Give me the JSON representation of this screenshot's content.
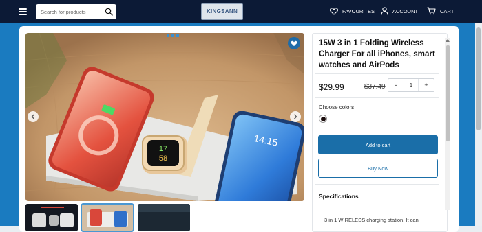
{
  "header": {
    "search_placeholder": "Search for products",
    "logo_text": "KINGSANN",
    "nav": {
      "favourites": "FAVOURITES",
      "account": "ACCOUNT",
      "cart": "CART"
    }
  },
  "product": {
    "title": "15W 3 in 1 Folding Wireless Charger For all iPhones, smart watches and AirPods",
    "price": "$29.99",
    "old_price": "$37.49",
    "quantity": "1",
    "qty_minus": "-",
    "qty_plus": "+",
    "colors_label": "Choose colors",
    "colors": [
      "#1a0c0c"
    ],
    "add_to_cart": "Add to cart",
    "buy_now": "Buy Now",
    "specifications_title": "Specifications",
    "specifications_text": "3 in 1 WIRELESS charging station. It can"
  },
  "image": {
    "watch_time_top": "17",
    "watch_time_bottom": "58",
    "phone_time": "14:15"
  },
  "colors": {
    "header_bg": "#0c1a36",
    "band": "#1a7bc0",
    "primary_button": "#1a6ea8"
  }
}
